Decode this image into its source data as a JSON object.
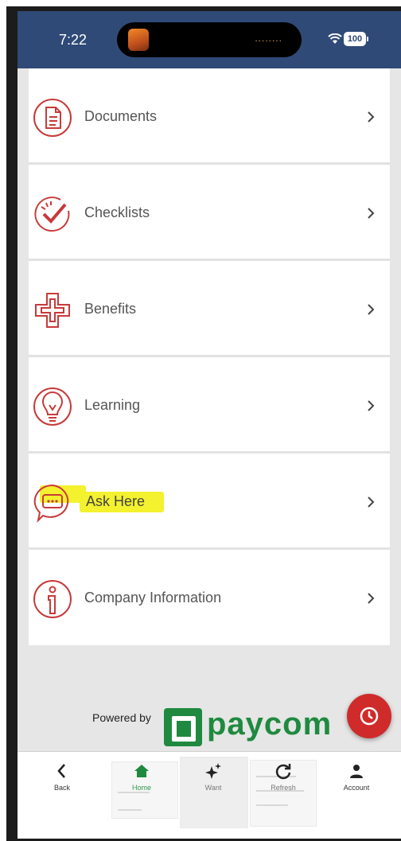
{
  "status_bar": {
    "time": "7:22",
    "island_text": "........",
    "battery": "100"
  },
  "menu": {
    "items": [
      {
        "label": "Documents",
        "icon": "document-icon"
      },
      {
        "label": "Checklists",
        "icon": "checklist-icon"
      },
      {
        "label": "Benefits",
        "icon": "benefits-cross-icon"
      },
      {
        "label": "Learning",
        "icon": "lightbulb-icon"
      },
      {
        "label": "Ask Here",
        "icon": "chat-bubble-icon",
        "highlighted": true
      },
      {
        "label": "Company Information",
        "icon": "info-icon"
      }
    ]
  },
  "footer": {
    "powered_by": "Powered by",
    "brand": "paycom"
  },
  "tabbar": {
    "back": "Back",
    "home": "Home",
    "want": "Want",
    "refresh": "Refresh",
    "account": "Account"
  },
  "colors": {
    "header": "#2f4a77",
    "accent_red": "#cf2b2b",
    "brand_green": "#1f8a3f",
    "highlight": "#f4f12e"
  }
}
